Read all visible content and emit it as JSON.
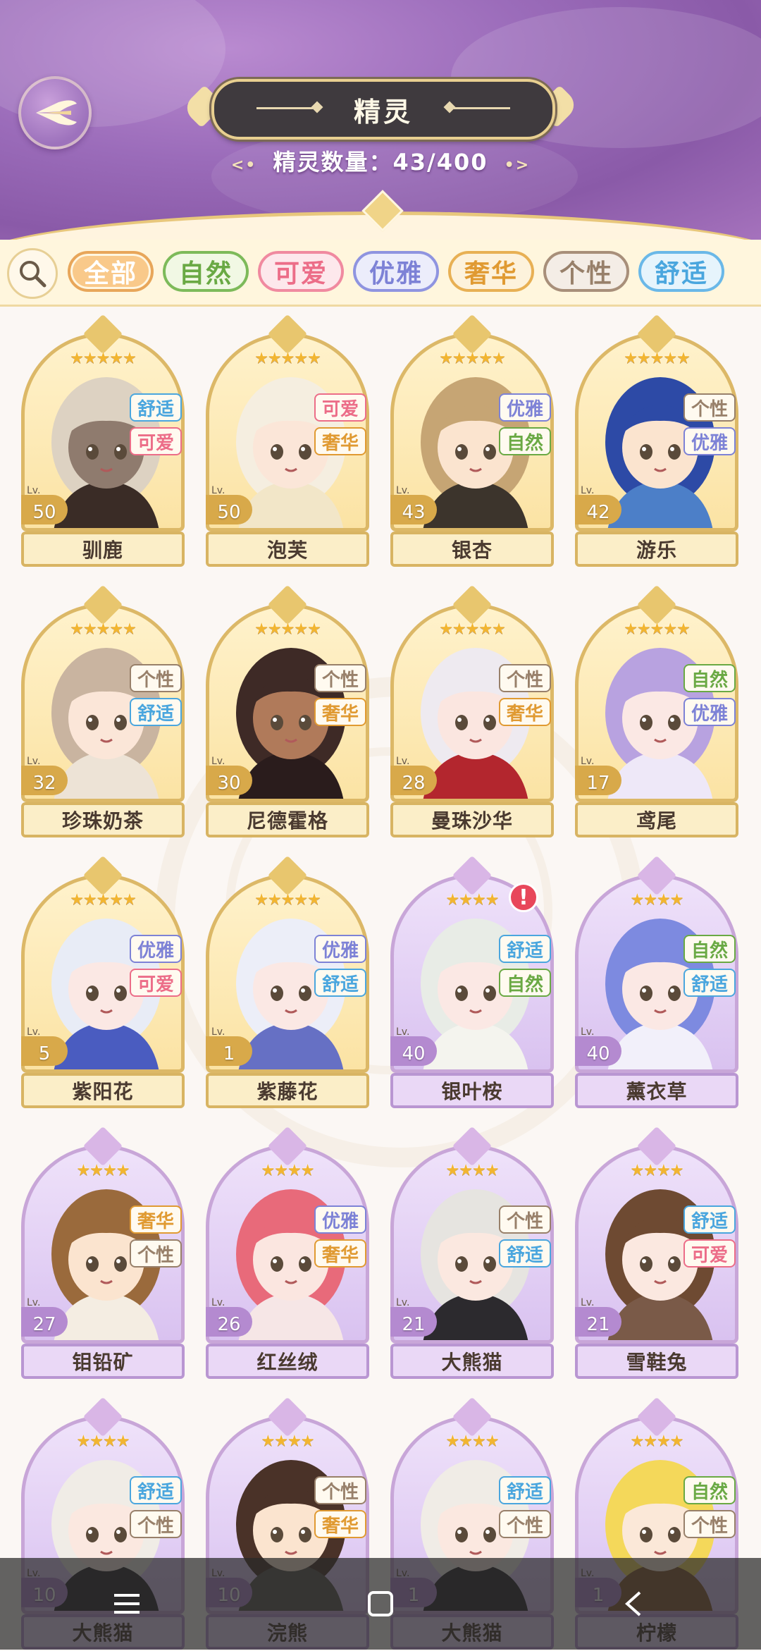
{
  "header": {
    "title": "精灵",
    "count_label": "精灵数量：43/400",
    "count_deco_left": "<•",
    "count_deco_right": "•>"
  },
  "filters": {
    "tabs": [
      {
        "label": "全部",
        "active": true,
        "color": "#e8a65a",
        "bg": "#f9c98a",
        "text": "#ffffff"
      },
      {
        "label": "自然",
        "active": false,
        "color": "#7dba5a",
        "bg": "#f1f8e4",
        "text": "#6aa944"
      },
      {
        "label": "可爱",
        "active": false,
        "color": "#f08aa0",
        "bg": "#fde8ec",
        "text": "#ec6d88"
      },
      {
        "label": "优雅",
        "active": false,
        "color": "#8f94e0",
        "bg": "#ecedfb",
        "text": "#7d82d6"
      },
      {
        "label": "奢华",
        "active": false,
        "color": "#e8b054",
        "bg": "#fdf2dc",
        "text": "#e09a32"
      },
      {
        "label": "个性",
        "active": false,
        "color": "#a88f7a",
        "bg": "#f4ede6",
        "text": "#98806a"
      },
      {
        "label": "舒适",
        "active": false,
        "color": "#6ab8e8",
        "bg": "#e6f4fc",
        "text": "#4aa6de"
      }
    ]
  },
  "tag_styles": {
    "舒适": "#4aa6de",
    "可爱": "#ec6d88",
    "奢华": "#e09a32",
    "优雅": "#7d82d6",
    "自然": "#6aa944",
    "个性": "#98806a"
  },
  "cards": [
    {
      "name": "驯鹿",
      "level": "50",
      "stars": "★★★★★",
      "tags": [
        "舒适",
        "可爱"
      ],
      "tier": "gold",
      "portrait": {
        "hair": "#ddd2c2",
        "skin": "#8f7b6e",
        "cloth": "#3a2c26"
      }
    },
    {
      "name": "泡芙",
      "level": "50",
      "stars": "★★★★★",
      "tags": [
        "可爱",
        "奢华"
      ],
      "tier": "gold",
      "portrait": {
        "hair": "#f5eee0",
        "skin": "#fbe6d8",
        "cloth": "#f2e6c8"
      }
    },
    {
      "name": "银杏",
      "level": "43",
      "stars": "★★★★★",
      "tags": [
        "优雅",
        "自然"
      ],
      "tier": "gold",
      "portrait": {
        "hair": "#c6a574",
        "skin": "#fbe4cf",
        "cloth": "#3c342c"
      }
    },
    {
      "name": "游乐",
      "level": "42",
      "stars": "★★★★★",
      "tags": [
        "个性",
        "优雅"
      ],
      "tier": "gold",
      "portrait": {
        "hair": "#2d4aa6",
        "skin": "#fbe4cf",
        "cloth": "#4c7fc8"
      }
    },
    {
      "name": "珍珠奶茶",
      "level": "32",
      "stars": "★★★★★",
      "tags": [
        "个性",
        "舒适"
      ],
      "tier": "gold",
      "portrait": {
        "hair": "#c9b4a0",
        "skin": "#fbe6d8",
        "cloth": "#ede3d6"
      }
    },
    {
      "name": "尼德霍格",
      "level": "30",
      "stars": "★★★★★",
      "tags": [
        "个性",
        "奢华"
      ],
      "tier": "gold",
      "portrait": {
        "hair": "#3e2a26",
        "skin": "#b07a5a",
        "cloth": "#2a1c1c"
      }
    },
    {
      "name": "曼珠沙华",
      "level": "28",
      "stars": "★★★★★",
      "tags": [
        "个性",
        "奢华"
      ],
      "tier": "gold",
      "portrait": {
        "hair": "#eeeaf0",
        "skin": "#fbe6e0",
        "cloth": "#b3262e"
      }
    },
    {
      "name": "鸢尾",
      "level": "17",
      "stars": "★★★★★",
      "tags": [
        "自然",
        "优雅"
      ],
      "tier": "gold",
      "portrait": {
        "hair": "#b8a2e0",
        "skin": "#fbe8e4",
        "cloth": "#eee8f8"
      }
    },
    {
      "name": "紫阳花",
      "level": "5",
      "stars": "★★★★★",
      "tags": [
        "优雅",
        "可爱"
      ],
      "tier": "gold",
      "portrait": {
        "hair": "#e8ecf6",
        "skin": "#fbe8e4",
        "cloth": "#4a5cc0"
      }
    },
    {
      "name": "紫藤花",
      "level": "1",
      "stars": "★★★★★",
      "tags": [
        "优雅",
        "舒适"
      ],
      "tier": "gold",
      "portrait": {
        "hair": "#eceef8",
        "skin": "#fbe8e4",
        "cloth": "#6670c4"
      }
    },
    {
      "name": "银叶桉",
      "level": "40",
      "stars": "★★★★",
      "tags": [
        "舒适",
        "自然"
      ],
      "tier": "purple",
      "alert": "!",
      "portrait": {
        "hair": "#e8ece6",
        "skin": "#fbe8e4",
        "cloth": "#f4f4ee"
      }
    },
    {
      "name": "薰衣草",
      "level": "40",
      "stars": "★★★★",
      "tags": [
        "自然",
        "舒适"
      ],
      "tier": "purple",
      "portrait": {
        "hair": "#7d8ae0",
        "skin": "#fbe8e4",
        "cloth": "#f2f0fa"
      }
    },
    {
      "name": "钼铅矿",
      "level": "27",
      "stars": "★★★★",
      "tags": [
        "奢华",
        "个性"
      ],
      "tier": "purple",
      "portrait": {
        "hair": "#9a6a3c",
        "skin": "#fbe4cf",
        "cloth": "#f4ede2"
      }
    },
    {
      "name": "红丝绒",
      "level": "26",
      "stars": "★★★★",
      "tags": [
        "优雅",
        "奢华"
      ],
      "tier": "purple",
      "portrait": {
        "hair": "#e86a7a",
        "skin": "#fbe6e0",
        "cloth": "#f6e6e6"
      }
    },
    {
      "name": "大熊猫",
      "level": "21",
      "stars": "★★★★",
      "tags": [
        "个性",
        "舒适"
      ],
      "tier": "purple",
      "portrait": {
        "hair": "#e6e4e0",
        "skin": "#fbe8e0",
        "cloth": "#2c2a2e"
      }
    },
    {
      "name": "雪鞋兔",
      "level": "21",
      "stars": "★★★★",
      "tags": [
        "舒适",
        "可爱"
      ],
      "tier": "purple",
      "portrait": {
        "hair": "#6e4a32",
        "skin": "#fbe8e0",
        "cloth": "#7a5a48"
      }
    },
    {
      "name": "大熊猫",
      "level": "10",
      "stars": "★★★★",
      "tags": [
        "舒适",
        "个性"
      ],
      "tier": "purple",
      "portrait": {
        "hair": "#f0ece6",
        "skin": "#fbe8e0",
        "cloth": "#2c2a2e"
      }
    },
    {
      "name": "浣熊",
      "level": "10",
      "stars": "★★★★",
      "tags": [
        "个性",
        "奢华"
      ],
      "tier": "purple",
      "portrait": {
        "hair": "#4a3228",
        "skin": "#fbe4cf",
        "cloth": "#5a5650"
      }
    },
    {
      "name": "大熊猫",
      "level": "1",
      "stars": "★★★★",
      "tags": [
        "舒适",
        "个性"
      ],
      "tier": "purple",
      "portrait": {
        "hair": "#f0ece6",
        "skin": "#fbe8e0",
        "cloth": "#2c2a2e"
      }
    },
    {
      "name": "柠檬",
      "level": "1",
      "stars": "★★★★",
      "tags": [
        "自然",
        "个性"
      ],
      "tier": "purple",
      "portrait": {
        "hair": "#f4d85a",
        "skin": "#fbe8d8",
        "cloth": "#8a5a30"
      }
    }
  ],
  "level_prefix": "Lv.",
  "navbar": {
    "items": [
      "menu-icon",
      "home-icon",
      "back-icon"
    ]
  }
}
